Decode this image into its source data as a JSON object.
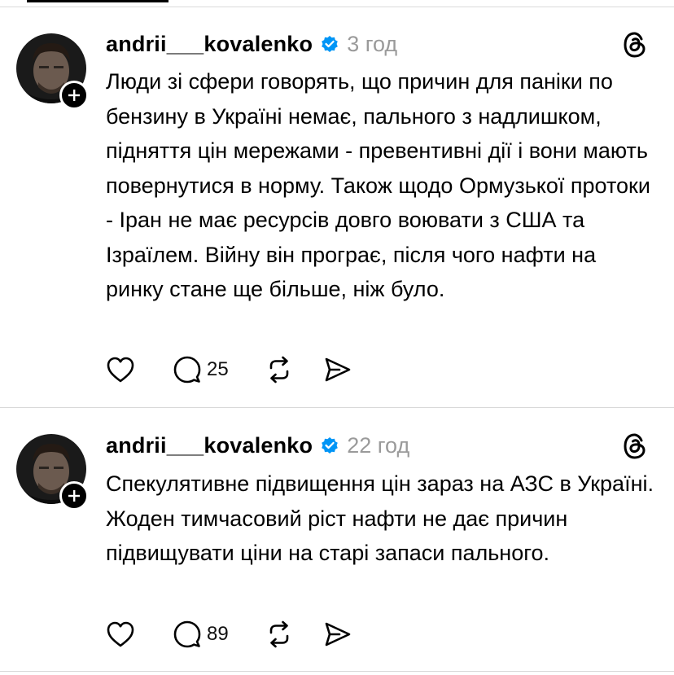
{
  "posts": [
    {
      "username": "andrii___kovalenko",
      "time": "3 год",
      "text": "Люди зі сфери говорять, що причин для паніки по бензину в Україні немає, пального з надлишком, підняття цін мережами - превентивні дії і вони мають повернутися в норму. Також щодо Ормузької протоки - Іран не має ресурсів довго воювати з США та Ізраїлем. Війну він програє, після чого нафти на ринку стане ще більше, ніж було.",
      "reply_count": "25"
    },
    {
      "username": "andrii___kovalenko",
      "time": "22 год",
      "text": "Спекулятивне підвищення цін зараз на АЗС в Україні. Жоден тимчасовий ріст нафти не дає причин підвищувати ціни на старі запаси пального.",
      "reply_count": "89"
    }
  ],
  "colors": {
    "verified": "#0095f6",
    "time": "#9a9a9a",
    "divider": "#d9d9d9"
  },
  "icons": [
    "plus-icon",
    "verified-icon",
    "threads-icon",
    "heart-icon",
    "comment-icon",
    "repost-icon",
    "share-icon"
  ]
}
